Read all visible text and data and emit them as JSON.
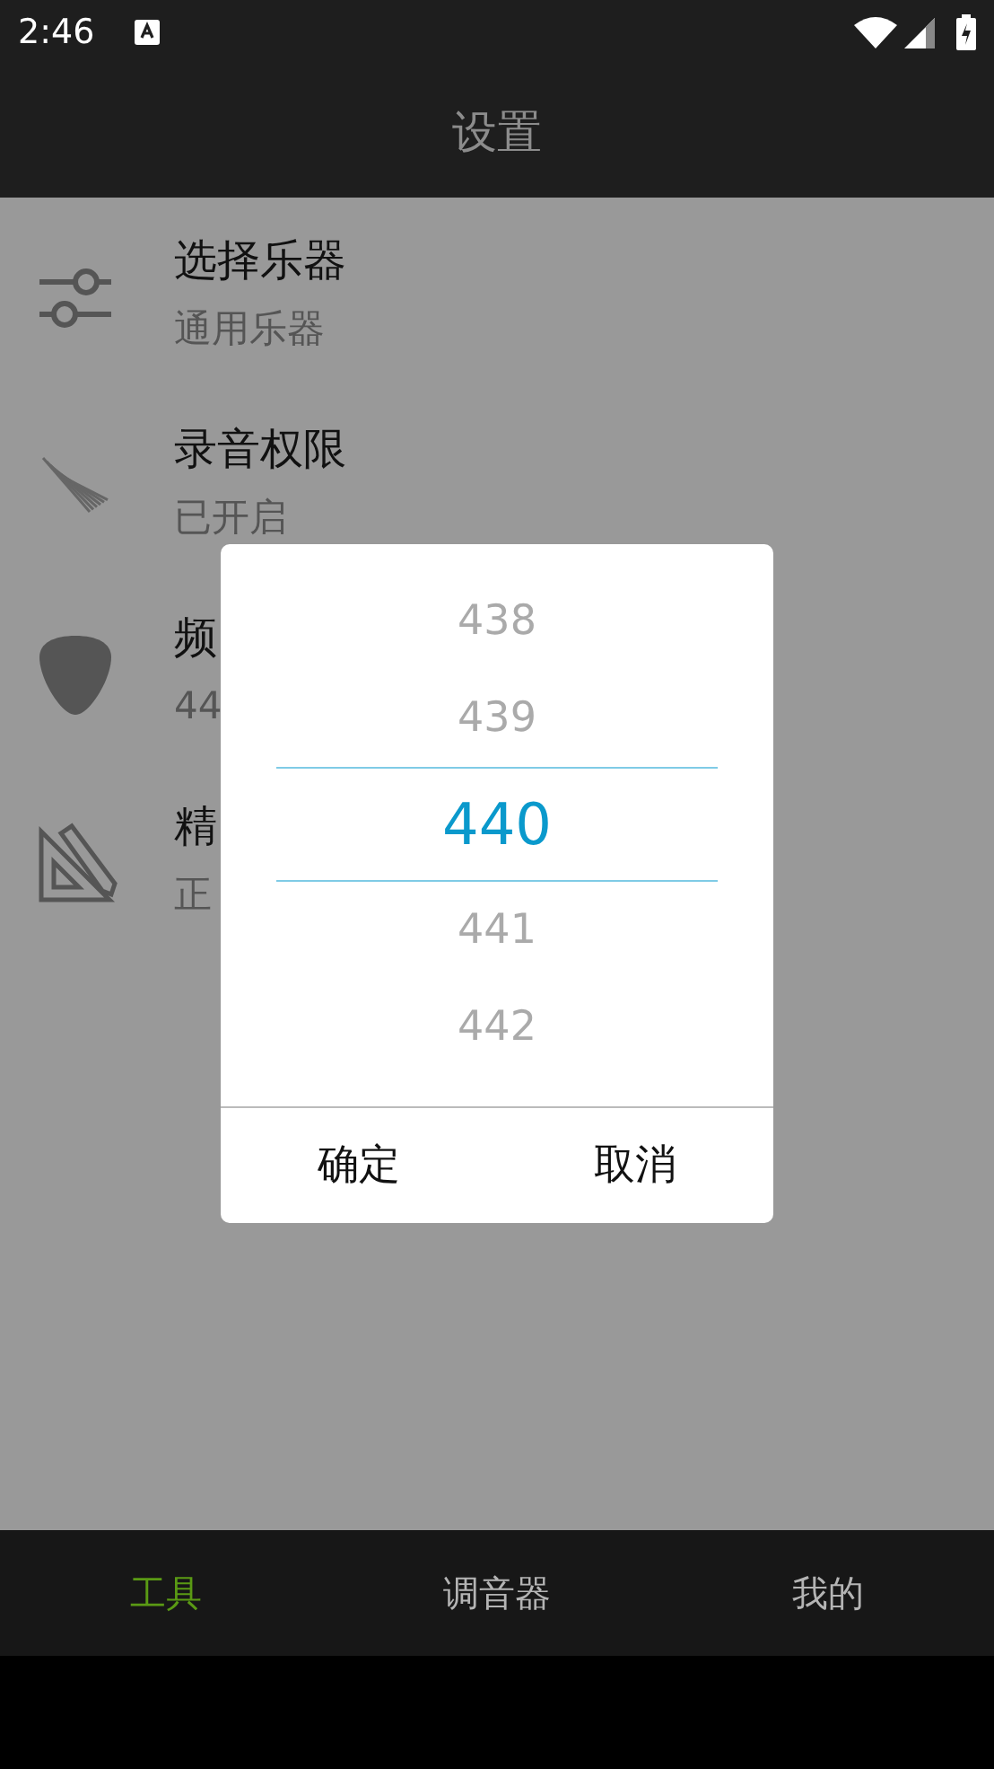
{
  "status_bar": {
    "time": "2:46"
  },
  "header": {
    "title": "设置"
  },
  "settings": [
    {
      "kind": "sliders",
      "title": "选择乐器",
      "subtitle": "通用乐器"
    },
    {
      "kind": "stripes",
      "title": "录音权限",
      "subtitle": "已开启"
    },
    {
      "kind": "pick",
      "title": "频",
      "subtitle": "44"
    },
    {
      "kind": "square",
      "title": "精",
      "subtitle": "正"
    }
  ],
  "picker_dialog": {
    "values": [
      {
        "label": "438",
        "selected": false
      },
      {
        "label": "439",
        "selected": false
      },
      {
        "label": "440",
        "selected": true
      },
      {
        "label": "441",
        "selected": false
      },
      {
        "label": "442",
        "selected": false
      }
    ],
    "buttons": [
      "确定",
      "取消"
    ]
  },
  "bottom_nav": [
    {
      "label": "工具",
      "selected": true
    },
    {
      "label": "调音器",
      "selected": false
    },
    {
      "label": "我的",
      "selected": false
    }
  ]
}
